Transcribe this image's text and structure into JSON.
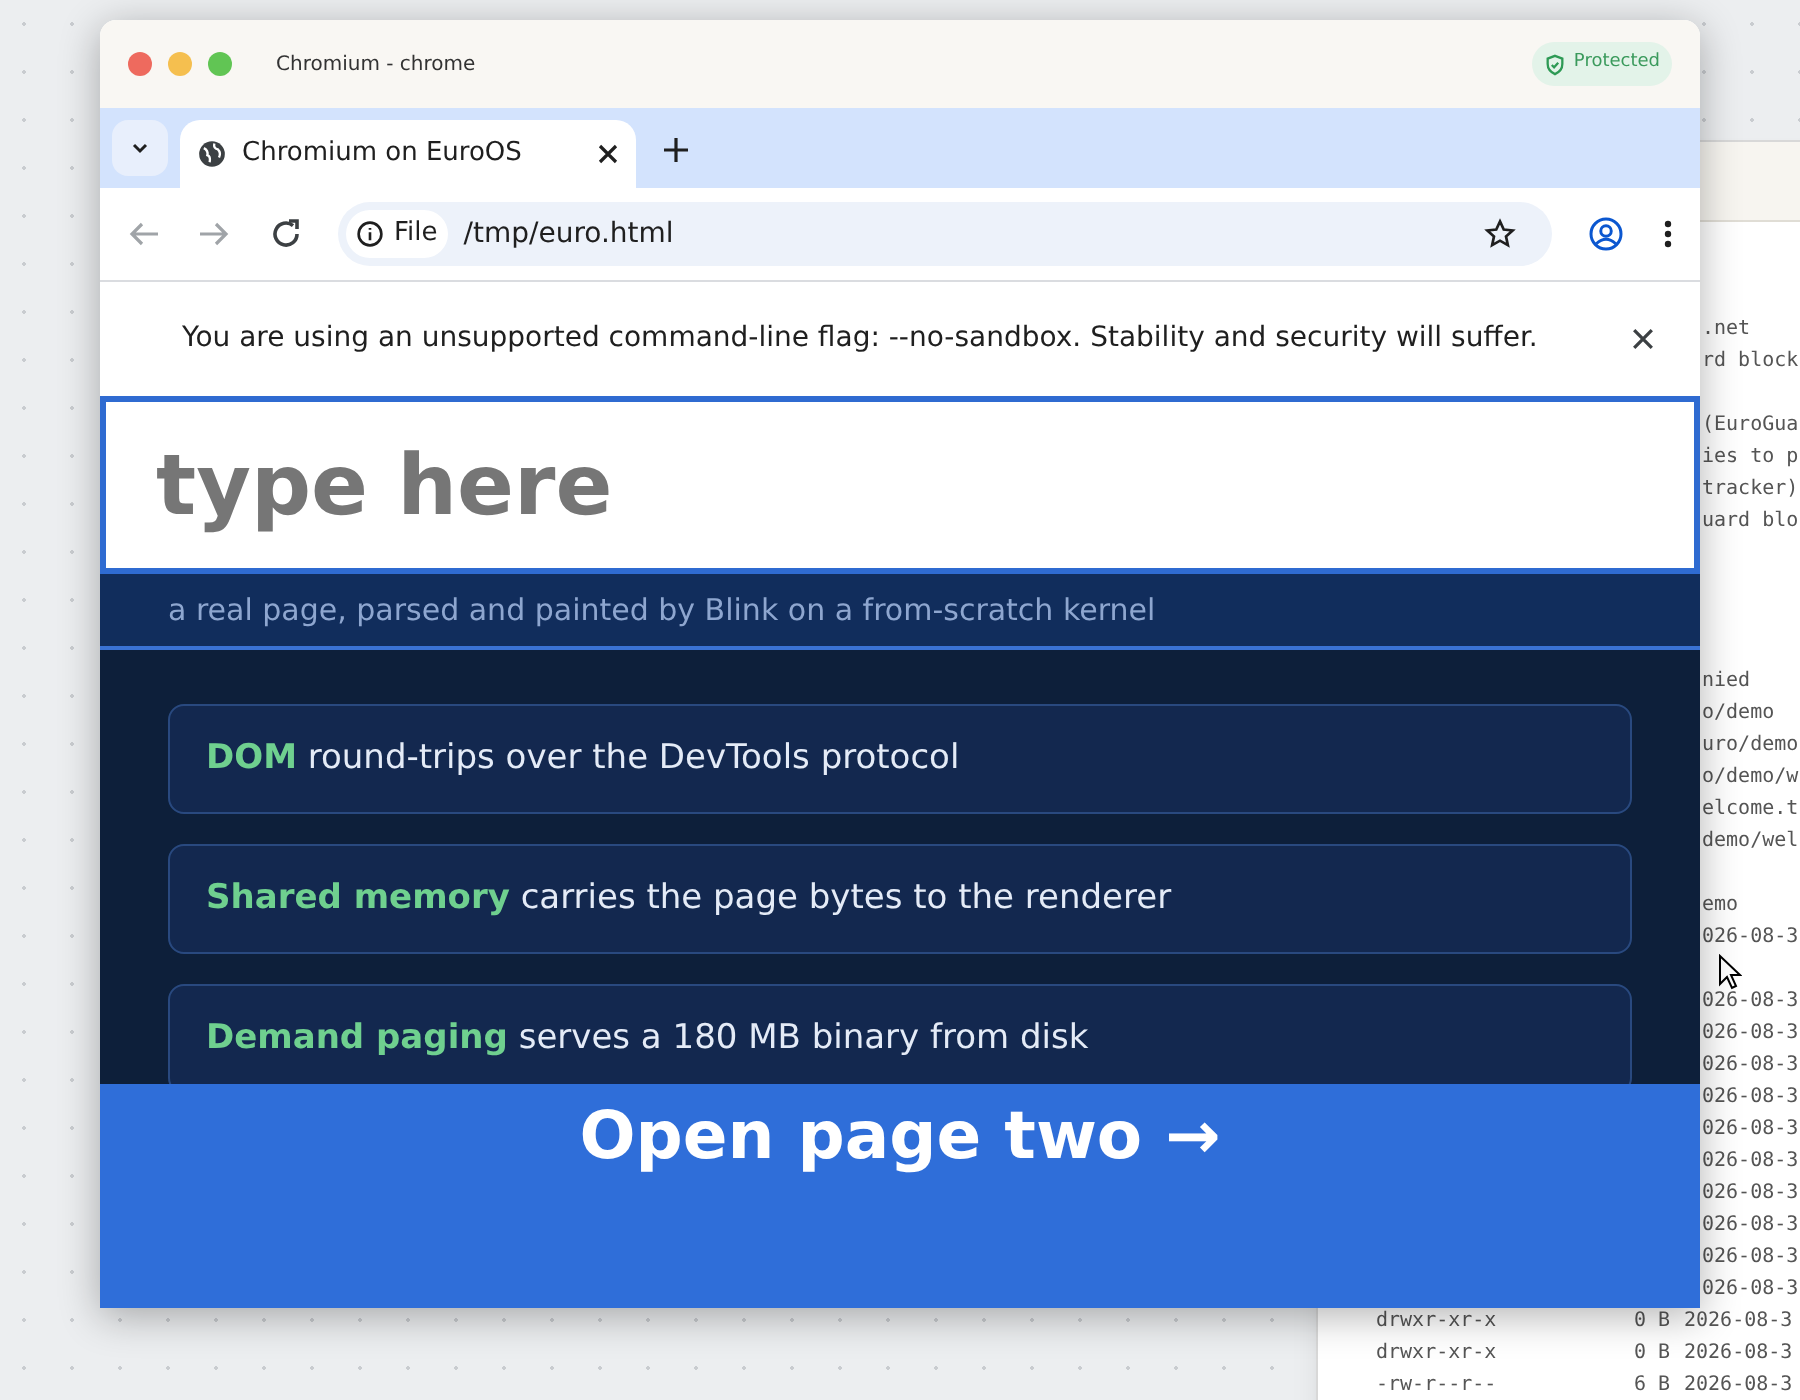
{
  "terminal": {
    "blocks": [
      [
        ".net",
        "rd block"
      ],
      [
        "(EuroGua",
        "ies to p",
        "tracker)",
        "uard blo"
      ],
      [
        "nied",
        "o/demo",
        "uro/demo",
        "o/demo/w",
        "elcome.t",
        "demo/wel"
      ],
      [
        "emo",
        "026-08-3"
      ],
      [
        "026-08-3",
        "026-08-3",
        "026-08-3",
        "026-08-3",
        "026-08-3",
        "026-08-3",
        "026-08-3",
        "026-08-3",
        "026-08-3",
        "026-08-3"
      ]
    ],
    "listing": [
      {
        "perms": "drwxr-xr-x",
        "size": "0 B",
        "date": "2026-08-3"
      },
      {
        "perms": "drwxr-xr-x",
        "size": "0 B",
        "date": "2026-08-3"
      },
      {
        "perms": "-rw-r--r--",
        "size": "6 B",
        "date": "2026-08-3"
      }
    ]
  },
  "browser": {
    "title": "Chromium - chrome",
    "badge": "Protected",
    "tabs": [
      {
        "title": "Chromium on EuroOS",
        "selected": true
      }
    ],
    "address": {
      "scheme": "File",
      "url": "/tmp/euro.html"
    },
    "infobar": "You are using an unsupported command-line flag: --no-sandbox. Stability and security will suffer."
  },
  "page": {
    "input": {
      "placeholder": "type here"
    },
    "subtitle": "a real page, parsed and painted by Blink on a from-scratch kernel",
    "features": [
      {
        "term": "DOM",
        "text": "round-trips over the DevTools protocol"
      },
      {
        "term": "Shared memory",
        "text": "carries the page bytes to the renderer"
      },
      {
        "term": "Demand paging",
        "text": "serves a 180 MB binary from disk"
      }
    ],
    "button": "Open page two →"
  }
}
